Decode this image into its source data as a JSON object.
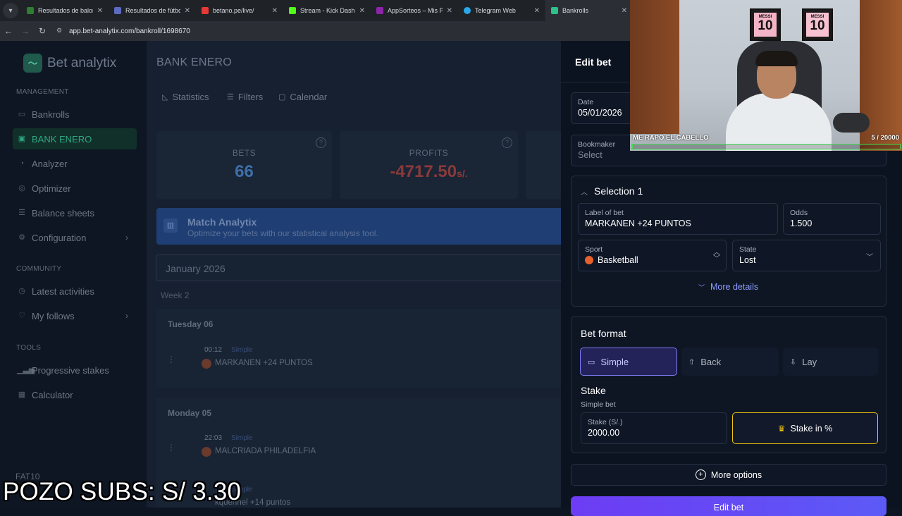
{
  "browser": {
    "tabs": [
      {
        "label": "Resultados de balon",
        "color": "#2e7d32"
      },
      {
        "label": "Resultados de fútbol",
        "color": "#5c6bc0"
      },
      {
        "label": "betano.pe/live/",
        "color": "#e53935"
      },
      {
        "label": "Stream - Kick Dashbo",
        "color": "#53fc18"
      },
      {
        "label": "AppSorteos – Mis Pro",
        "color": "#8e24aa"
      },
      {
        "label": "Telegram Web",
        "color": "#29a9eb"
      },
      {
        "label": "Bankrolls",
        "color": "#2fbf8a"
      }
    ],
    "url": "app.bet-analytix.com/bankroll/1698670"
  },
  "sidebar": {
    "logo": "Bet analytix",
    "management_label": "MANAGEMENT",
    "management": [
      {
        "label": "Bankrolls",
        "icon": "folder-icon"
      },
      {
        "label": "BANK ENERO",
        "icon": "wallet-icon",
        "active": true
      },
      {
        "label": "Analyzer",
        "icon": "clock-icon"
      },
      {
        "label": "Optimizer",
        "icon": "compass-icon"
      },
      {
        "label": "Balance sheets",
        "icon": "sheet-icon"
      },
      {
        "label": "Configuration",
        "icon": "settings-icon"
      }
    ],
    "community_label": "COMMUNITY",
    "community": [
      {
        "label": "Latest activities",
        "icon": "activity-icon"
      },
      {
        "label": "My follows",
        "icon": "follows-icon"
      }
    ],
    "tools_label": "TOOLS",
    "tools": [
      {
        "label": "Progressive stakes",
        "icon": "bars-icon"
      },
      {
        "label": "Calculator",
        "icon": "calculator-icon"
      }
    ],
    "user": "FAT10"
  },
  "main": {
    "title": "BANK ENERO",
    "toolbar": {
      "statistics": "Statistics",
      "filters": "Filters",
      "calendar": "Calendar"
    },
    "cards": [
      {
        "title": "BETS",
        "value": "66",
        "color": "#3d6fa8"
      },
      {
        "title": "PROFITS",
        "value": "-4717.50",
        "unit": "s/.",
        "color": "#8a3a3a"
      }
    ],
    "banner": {
      "title": "Match Analytix",
      "subtitle": "Optimize your bets with our statistical analysis tool."
    },
    "month": "January 2026",
    "week": "Week 2",
    "days": [
      {
        "label": "Tuesday 06",
        "bets": [
          {
            "time": "00:12",
            "type": "Simple",
            "label": "MARKANEN +24 PUNTOS"
          }
        ]
      },
      {
        "label": "Monday 05",
        "bets": [
          {
            "time": "22:03",
            "type": "Simple",
            "label": "MALCRIADA PHILADELFIA"
          },
          {
            "time": "",
            "type": "Simple",
            "label": "kquennel +14 puntos"
          }
        ]
      }
    ]
  },
  "panel": {
    "title": "Edit bet",
    "date_label": "Date",
    "date_value": "05/01/2026",
    "bookmaker_label": "Bookmaker",
    "bookmaker_placeholder": "Select",
    "selection_title": "Selection 1",
    "label_of_bet_label": "Label of bet",
    "label_of_bet_value": "MARKANEN +24 PUNTOS",
    "odds_label": "Odds",
    "odds_value": "1.500",
    "sport_label": "Sport",
    "sport_value": "Basketball",
    "state_label": "State",
    "state_value": "Lost",
    "more_details": "More details",
    "bet_format_title": "Bet format",
    "formats": {
      "simple": "Simple",
      "back": "Back",
      "lay": "Lay"
    },
    "stake_title": "Stake",
    "stake_sub": "Simple bet",
    "stake_label": "Stake (S/.)",
    "stake_value": "2000.00",
    "stake_pct": "Stake in %",
    "more_options": "More options",
    "submit": "Edit bet"
  },
  "webcam": {
    "caption": "ME RAPO EL CABELLO",
    "goal": "5  / 20000",
    "goal_progress": 0.00025,
    "jersey_name": "MESSI",
    "jersey_number": "10"
  },
  "overlay": {
    "pozo": "POZO SUBS: S/ 3.30"
  }
}
